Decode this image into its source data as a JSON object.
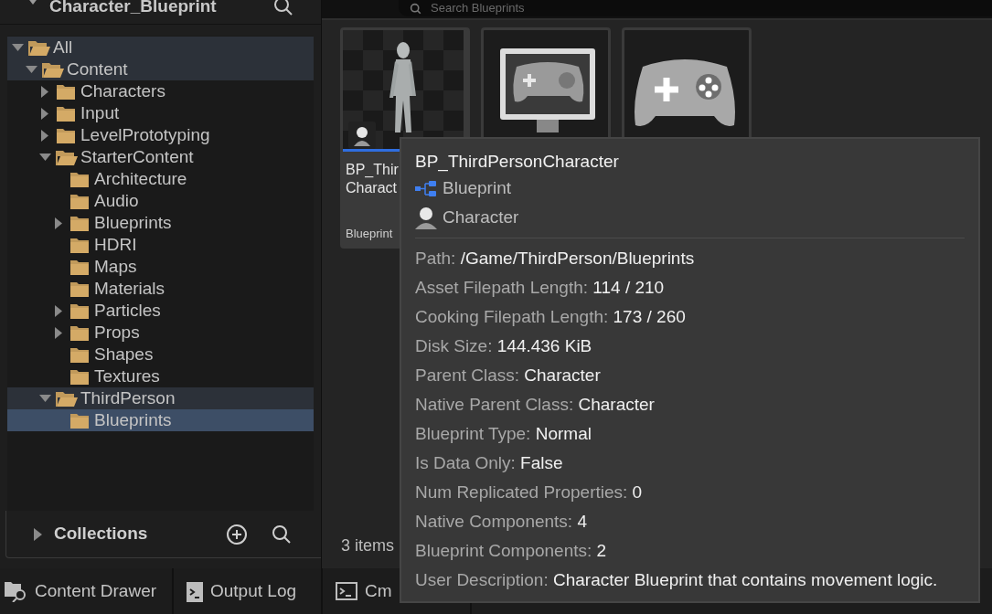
{
  "panel": {
    "title": "Character_Blueprint"
  },
  "tree": [
    {
      "label": "All",
      "expanded": true,
      "highlighted": true,
      "selected": false,
      "children": [
        {
          "label": "Content",
          "expanded": true,
          "highlighted": true,
          "selected": false,
          "children": [
            {
              "label": "Characters",
              "expanded": false,
              "highlighted": false,
              "selected": false
            },
            {
              "label": "Input",
              "expanded": false,
              "highlighted": false,
              "selected": false
            },
            {
              "label": "LevelPrototyping",
              "expanded": false,
              "highlighted": false,
              "selected": false
            },
            {
              "label": "StarterContent",
              "expanded": true,
              "highlighted": false,
              "selected": false,
              "children": [
                {
                  "label": "Architecture",
                  "highlighted": false,
                  "selected": false
                },
                {
                  "label": "Audio",
                  "highlighted": false,
                  "selected": false
                },
                {
                  "label": "Blueprints",
                  "expanded": false,
                  "highlighted": false,
                  "selected": false
                },
                {
                  "label": "HDRI",
                  "highlighted": false,
                  "selected": false
                },
                {
                  "label": "Maps",
                  "highlighted": false,
                  "selected": false
                },
                {
                  "label": "Materials",
                  "highlighted": false,
                  "selected": false
                },
                {
                  "label": "Particles",
                  "expanded": false,
                  "highlighted": false,
                  "selected": false
                },
                {
                  "label": "Props",
                  "expanded": false,
                  "highlighted": false,
                  "selected": false
                },
                {
                  "label": "Shapes",
                  "highlighted": false,
                  "selected": false
                },
                {
                  "label": "Textures",
                  "highlighted": false,
                  "selected": false
                }
              ]
            },
            {
              "label": "ThirdPerson",
              "expanded": true,
              "highlighted": true,
              "selected": false,
              "children": [
                {
                  "label": "Blueprints",
                  "selected": true
                }
              ]
            }
          ]
        }
      ]
    }
  ],
  "collections": {
    "label": "Collections",
    "expanded": false
  },
  "search": {
    "placeholder": "Search Blueprints"
  },
  "assets": [
    {
      "kind": "character",
      "label_lines": [
        "BP_Thir",
        "Charact"
      ],
      "type": "Blueprint",
      "selected": true
    },
    {
      "kind": "gamemode",
      "selected": false
    },
    {
      "kind": "controller",
      "selected": false
    }
  ],
  "item_count": "3 items",
  "bottom_tabs": [
    {
      "kind": "drawer",
      "label": "Content Drawer"
    },
    {
      "kind": "log",
      "label": "Output Log"
    },
    {
      "kind": "cmd",
      "label": "Cm"
    }
  ],
  "tooltip": {
    "title": "BP_ThirdPersonCharacter",
    "type": "Blueprint",
    "class": "Character",
    "properties": [
      {
        "key": "Path:",
        "value": "/Game/ThirdPerson/Blueprints"
      },
      {
        "key": "Asset Filepath Length:",
        "value": "114 / 210"
      },
      {
        "key": "Cooking Filepath Length:",
        "value": "173 / 260"
      },
      {
        "key": "Disk Size:",
        "value": "144.436 KiB"
      },
      {
        "key": "Parent Class:",
        "value": "Character"
      },
      {
        "key": "Native Parent Class:",
        "value": "Character"
      },
      {
        "key": "Blueprint Type:",
        "value": "Normal"
      },
      {
        "key": "Is Data Only:",
        "value": "False"
      },
      {
        "key": "Num Replicated Properties:",
        "value": "0"
      },
      {
        "key": "Native Components:",
        "value": "4"
      },
      {
        "key": "Blueprint Components:",
        "value": "2"
      },
      {
        "key": "User Description:",
        "value": "Character Blueprint that contains movement logic."
      }
    ]
  }
}
